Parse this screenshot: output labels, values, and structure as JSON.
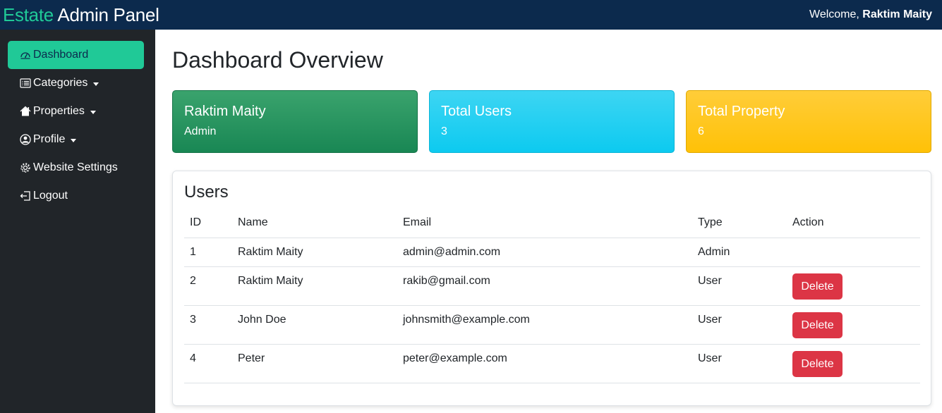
{
  "header": {
    "brand_accent": "Estate",
    "brand_rest": "Admin Panel",
    "welcome_prefix": "Welcome,",
    "welcome_user": "Raktim Maity"
  },
  "sidebar": {
    "items": [
      {
        "label": "Dashboard",
        "icon": "speedometer-icon",
        "active": true
      },
      {
        "label": "Categories",
        "icon": "list-icon",
        "dropdown": true
      },
      {
        "label": "Properties",
        "icon": "house-icon",
        "dropdown": true
      },
      {
        "label": "Profile",
        "icon": "user-circle-icon",
        "dropdown": true
      },
      {
        "label": "Website Settings",
        "icon": "gear-icon"
      },
      {
        "label": "Logout",
        "icon": "logout-icon"
      }
    ]
  },
  "main": {
    "title": "Dashboard Overview",
    "cards": [
      {
        "title": "Raktim Maity",
        "value": "Admin",
        "color": "#198754"
      },
      {
        "title": "Total Users",
        "value": "3",
        "color": "#0dcaf0"
      },
      {
        "title": "Total Property",
        "value": "6",
        "color": "#ffc107"
      }
    ],
    "users": {
      "title": "Users",
      "columns": [
        "ID",
        "Name",
        "Email",
        "Type",
        "Action"
      ],
      "rows": [
        {
          "id": "1",
          "name": "Raktim Maity",
          "email": "admin@admin.com",
          "type": "Admin",
          "action": ""
        },
        {
          "id": "2",
          "name": "Raktim Maity",
          "email": "rakib@gmail.com",
          "type": "User",
          "action": "Delete"
        },
        {
          "id": "3",
          "name": "John Doe",
          "email": "johnsmith@example.com",
          "type": "User",
          "action": "Delete"
        },
        {
          "id": "4",
          "name": "Peter",
          "email": "peter@example.com",
          "type": "User",
          "action": "Delete"
        }
      ]
    }
  },
  "colors": {
    "topbar": "#0c2a4d",
    "sidebar": "#212529",
    "accent": "#20c997",
    "danger": "#dc3545"
  }
}
